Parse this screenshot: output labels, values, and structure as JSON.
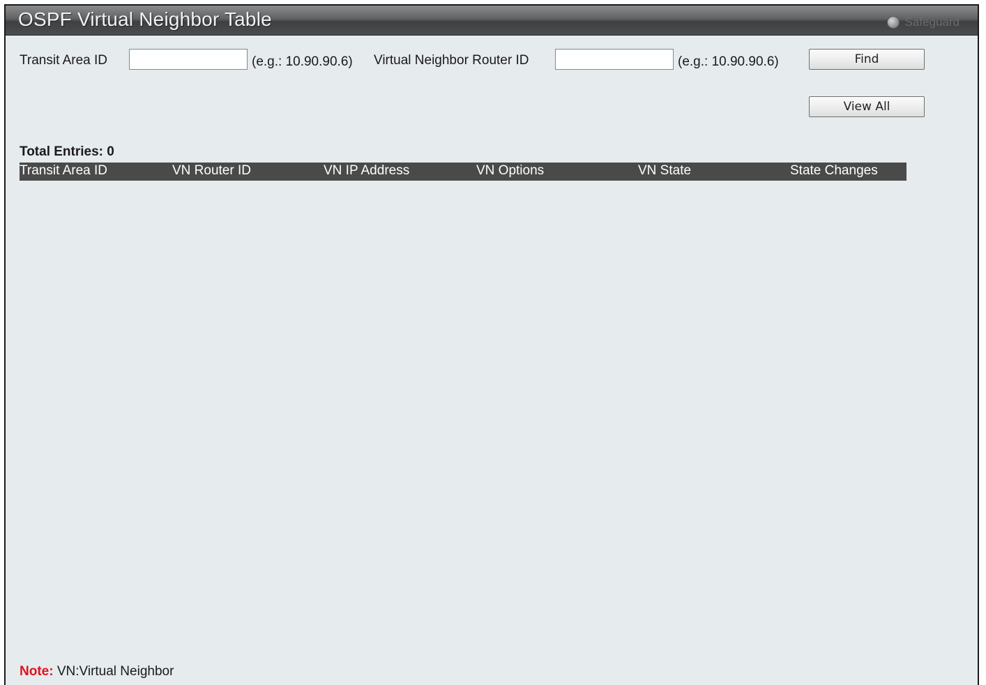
{
  "window": {
    "title": "OSPF Virtual Neighbor Table",
    "safeguard_label": "Safeguard"
  },
  "search": {
    "transit_area_label": "Transit Area ID",
    "transit_area_value": "",
    "transit_area_hint": "(e.g.: 10.90.90.6)",
    "router_id_label": "Virtual Neighbor Router ID",
    "router_id_value": "",
    "router_id_hint": "(e.g.: 10.90.90.6)",
    "find_label": "Find",
    "view_all_label": "View All"
  },
  "table": {
    "total_entries": "Total Entries: 0",
    "columns": [
      "Transit Area ID",
      "VN Router ID",
      "VN IP Address",
      "VN Options",
      "VN State",
      "State Changes"
    ],
    "rows": []
  },
  "note": {
    "key": "Note:",
    "text": " VN:Virtual Neighbor"
  },
  "colors": {
    "header_bg": "#4a4a4a",
    "page_bg": "#e6ebee",
    "note_key": "#e0141e"
  }
}
